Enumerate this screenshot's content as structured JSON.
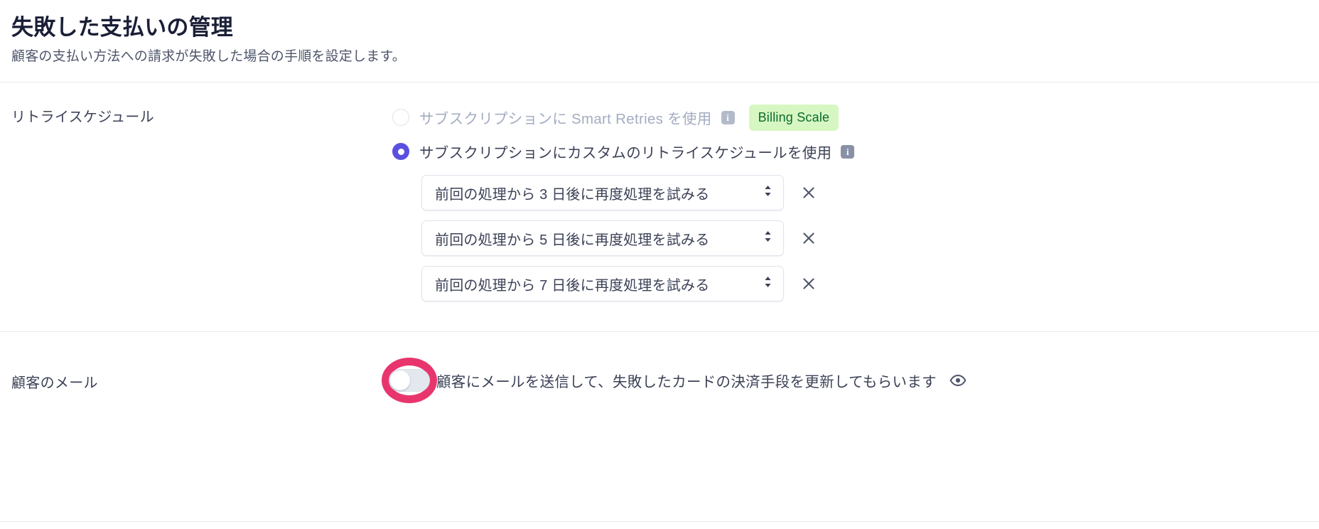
{
  "header": {
    "title": "失敗した支払いの管理",
    "subtitle": "顧客の支払い方法への請求が失敗した場合の手順を設定します。"
  },
  "retry_section": {
    "label": "リトライスケジュール",
    "options": [
      {
        "text": "サブスクリプションに Smart Retries を使用",
        "selected": false,
        "disabled": true,
        "info_icon": "info-icon",
        "badge": "Billing Scale"
      },
      {
        "text": "サブスクリプションにカスタムのリトライスケジュールを使用",
        "selected": true,
        "disabled": false,
        "info_icon": "info-icon",
        "badge": null
      }
    ],
    "schedules": [
      {
        "value": "前回の処理から 3 日後に再度処理を試みる",
        "remove_icon": "close-icon",
        "chevron_icon": "chevron-up-down-icon"
      },
      {
        "value": "前回の処理から 5 日後に再度処理を試みる",
        "remove_icon": "close-icon",
        "chevron_icon": "chevron-up-down-icon"
      },
      {
        "value": "前回の処理から 7 日後に再度処理を試みる",
        "remove_icon": "close-icon",
        "chevron_icon": "chevron-up-down-icon"
      }
    ]
  },
  "email_section": {
    "label": "顧客のメール",
    "toggle_label": "顧客にメールを送信して、失敗したカードの決済手段を更新してもらいます",
    "toggle_on": false,
    "preview_icon": "eye-icon",
    "highlight_color": "#e8356d"
  },
  "colors": {
    "accent": "#5a50e0",
    "badge_bg": "#d7f7c2",
    "badge_text": "#0b6b2f",
    "text": "#3c4257",
    "muted": "#a3acc0",
    "divider": "#e7eaf0"
  }
}
